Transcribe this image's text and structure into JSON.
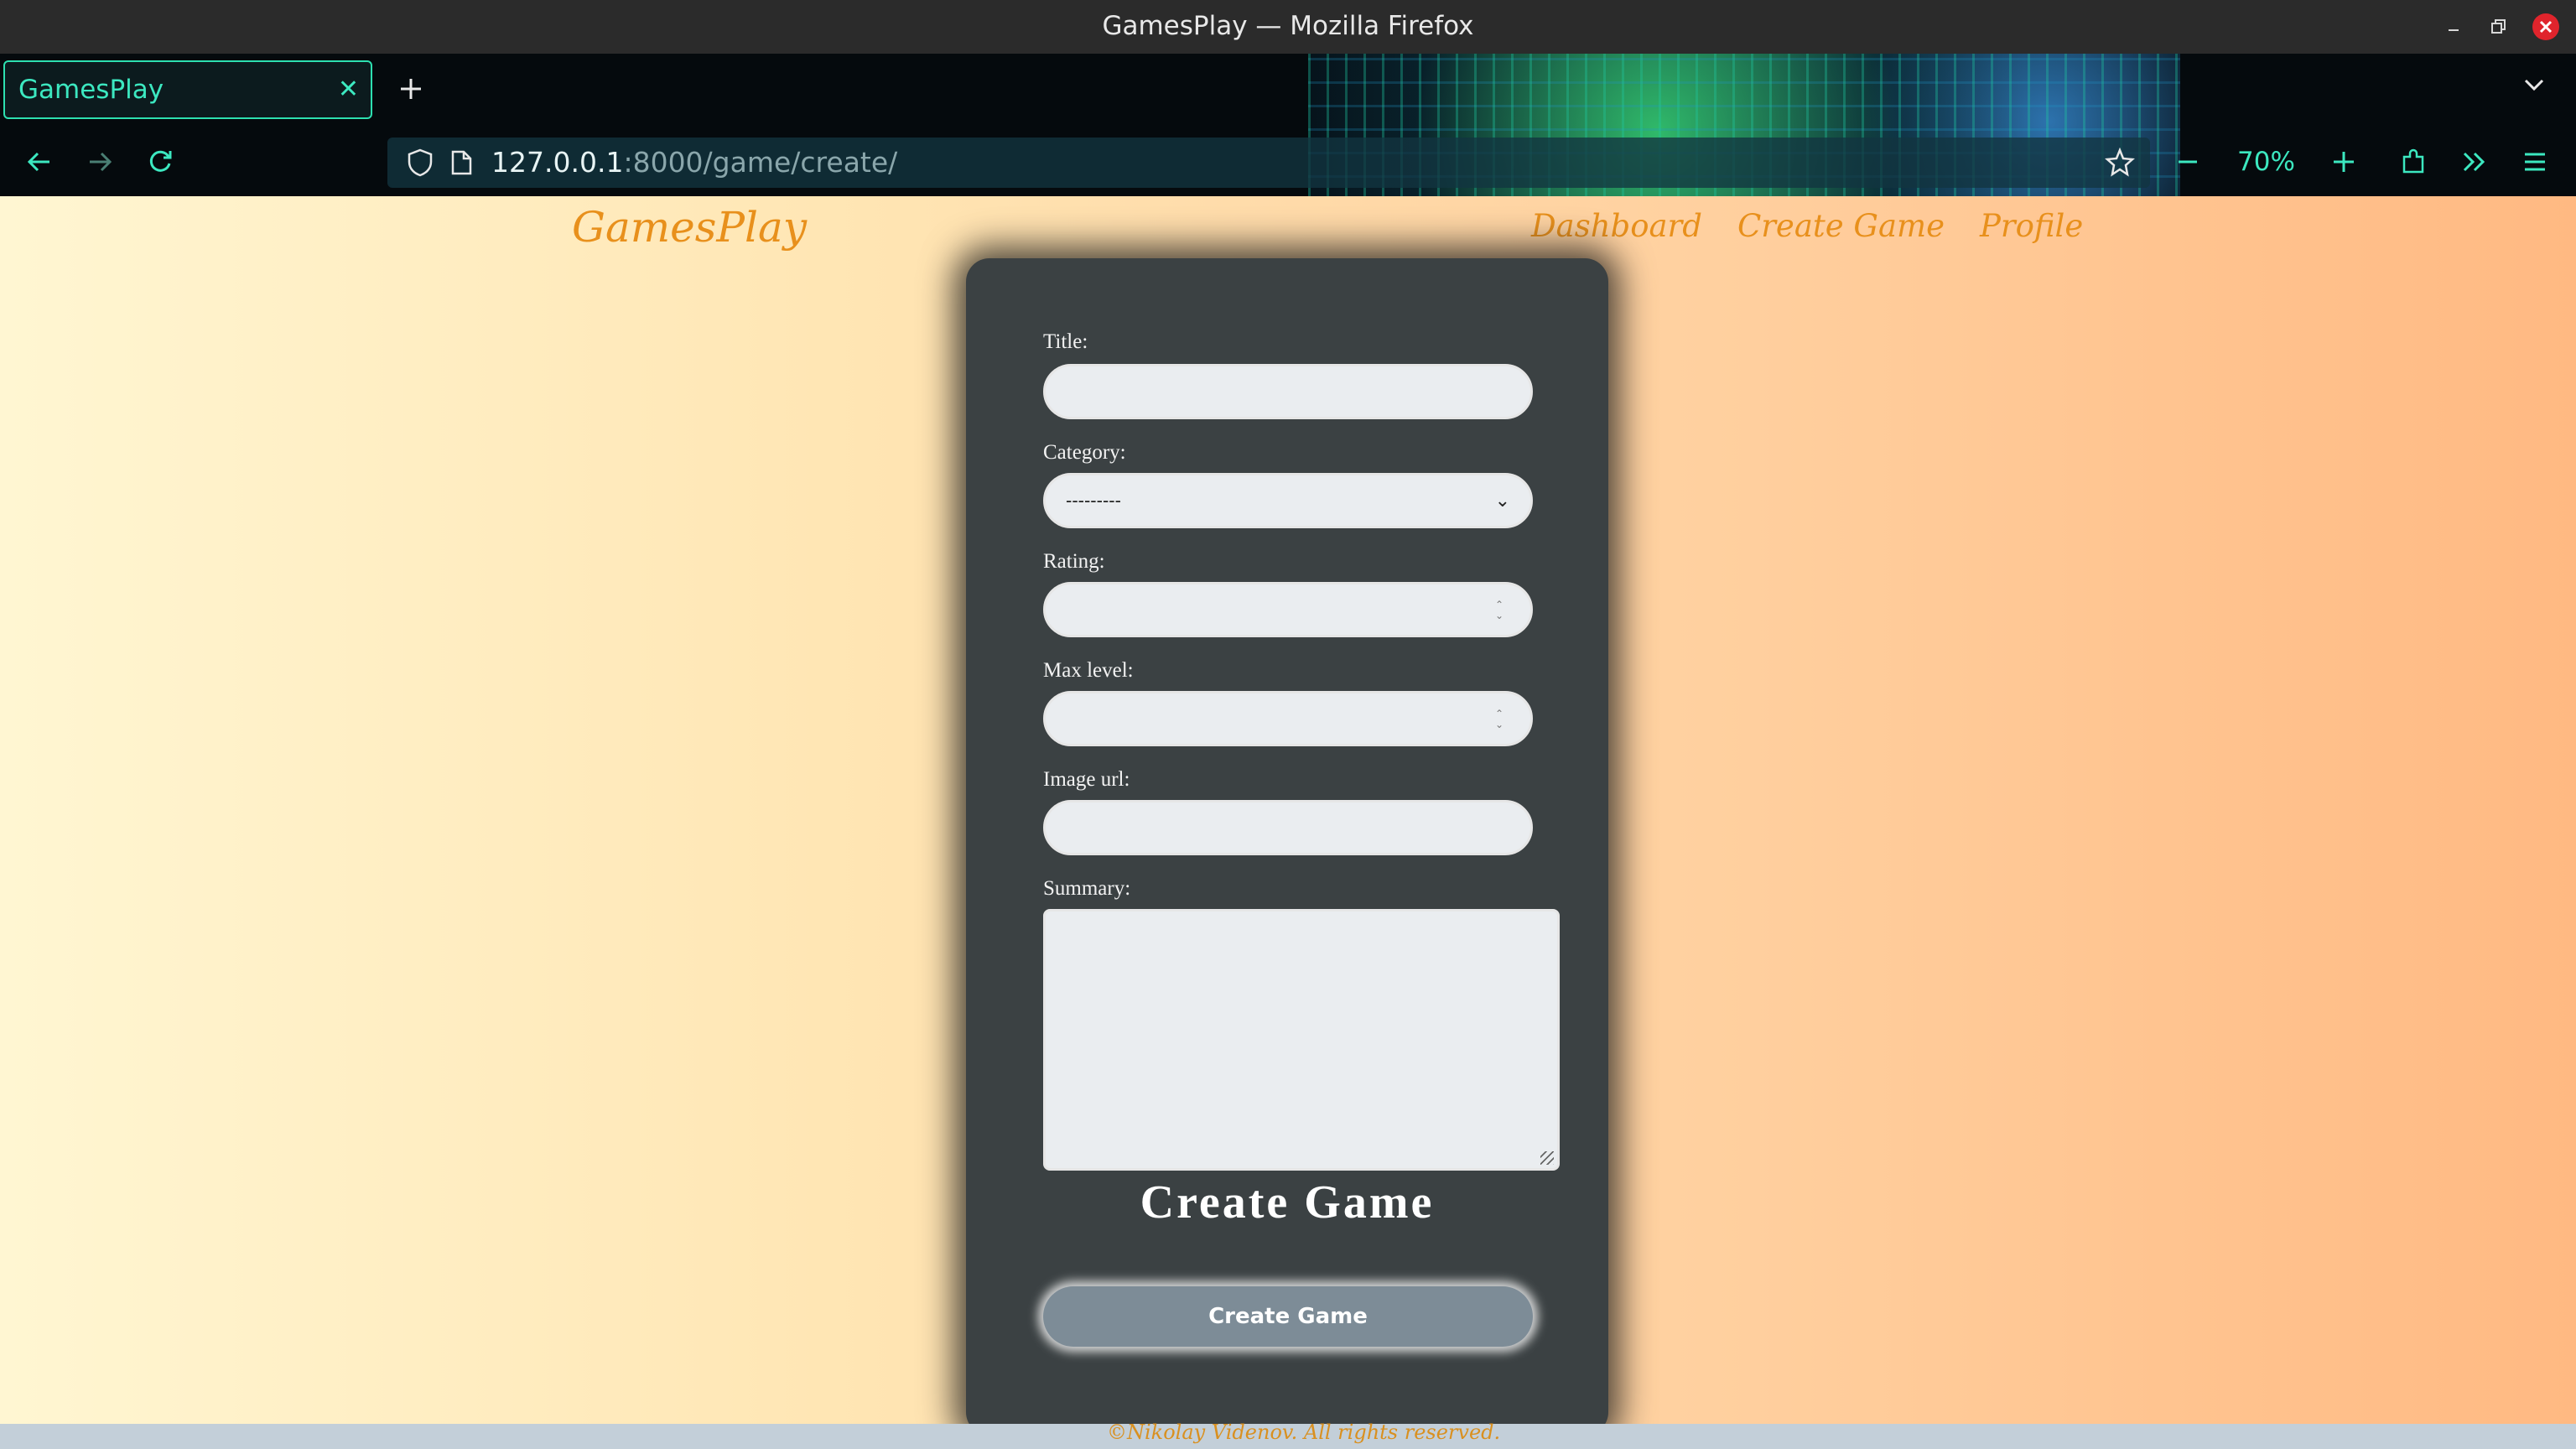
{
  "window": {
    "title": "GamesPlay — Mozilla Firefox"
  },
  "browser": {
    "tab_title": "GamesPlay",
    "url_host": "127.0.0.1",
    "url_rest": ":8000/game/create/",
    "zoom": "70%",
    "icons": {
      "back": "arrow-left-icon",
      "forward": "arrow-right-icon",
      "reload": "reload-icon",
      "shield": "shield-icon",
      "page": "page-icon",
      "bookmark": "star-icon",
      "zoom_out": "minus-icon",
      "zoom_in": "plus-icon",
      "extensions": "puzzle-icon",
      "overflow": "chevron-double-right-icon",
      "menu": "hamburger-menu-icon"
    }
  },
  "site": {
    "brand": "GamesPlay",
    "nav": [
      {
        "label": "Dashboard"
      },
      {
        "label": "Create Game"
      },
      {
        "label": "Profile"
      }
    ]
  },
  "form": {
    "title_label": "Title:",
    "category_label": "Category:",
    "category_selected": "---------",
    "rating_label": "Rating:",
    "max_level_label": "Max level:",
    "image_url_label": "Image url:",
    "summary_label": "Summary:",
    "heading": "Create Game",
    "submit_label": "Create Game"
  },
  "footer": {
    "text": "©Nikolay Videnov. All rights reserved."
  },
  "colors": {
    "accent_teal": "#3ce8c0",
    "brand_orange": "#e8901c",
    "card_bg": "#3b4143",
    "button_bg": "#7d8c97"
  }
}
